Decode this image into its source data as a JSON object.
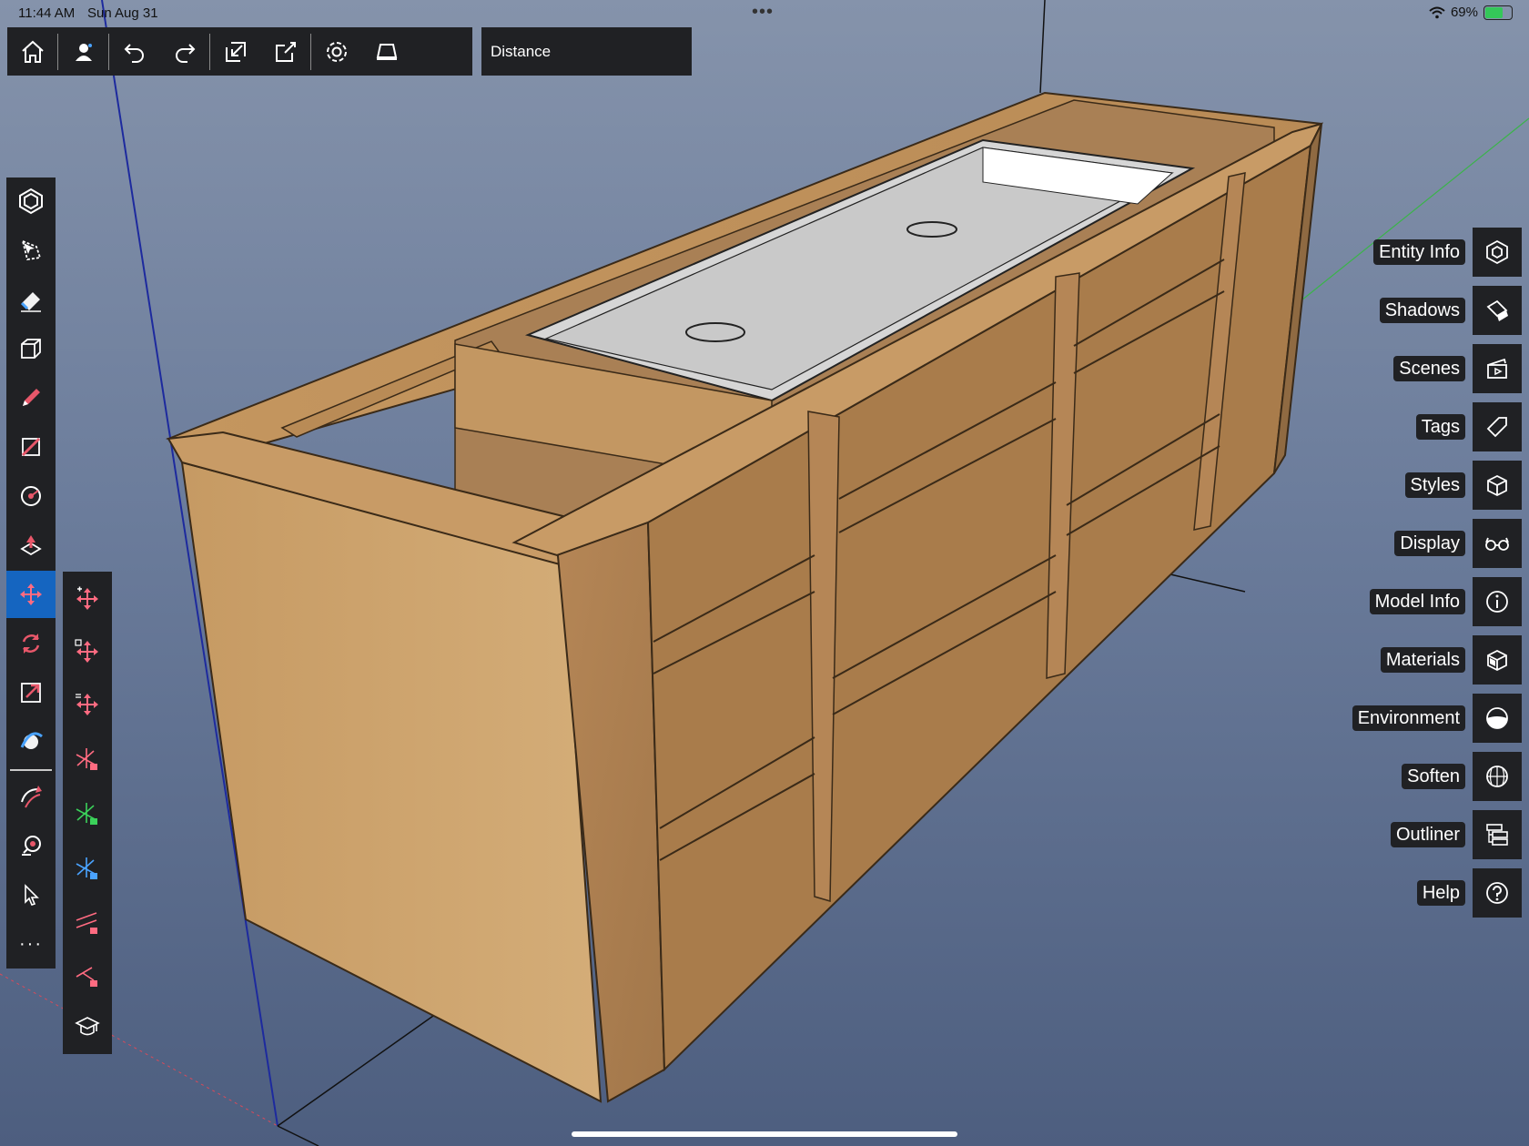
{
  "status_bar": {
    "time": "11:44 AM",
    "date": "Sun Aug 31",
    "battery": "69%",
    "battery_level": 0.69
  },
  "toolbar": {
    "buttons": [
      "home-icon",
      "profile-icon",
      "undo-icon",
      "redo-icon",
      "import-icon",
      "export-icon",
      "settings-icon",
      "view-icon"
    ],
    "measurement_label": "Distance"
  },
  "left_tools": [
    "select-all-icon",
    "lasso-icon",
    "eraser-icon",
    "push-pull-icon",
    "pencil-icon",
    "rectangle-icon",
    "circle-icon",
    "paint-bucket-icon",
    "move-icon",
    "rotate-icon",
    "scale-icon",
    "orbit-icon",
    "follow-me-icon",
    "tape-measure-icon",
    "select-icon",
    "more-icon"
  ],
  "move_sub_tools": [
    "move-icon",
    "move-copy-icon",
    "move-array-icon",
    "lock-red-axis-icon",
    "lock-green-axis-icon",
    "lock-blue-axis-icon",
    "lock-parallel-icon",
    "lock-perpendicular-icon",
    "tutorial-icon"
  ],
  "colors": {
    "toolbar_bg": "#202124",
    "active_tool": "#1565c0",
    "axis_red": "#d84a5a",
    "axis_blue": "#1d2a9e",
    "axis_green": "#3bb34a"
  },
  "panels": [
    {
      "label": "Entity Info",
      "icon": "entity-info-icon"
    },
    {
      "label": "Shadows",
      "icon": "shadows-icon"
    },
    {
      "label": "Scenes",
      "icon": "scenes-icon"
    },
    {
      "label": "Tags",
      "icon": "tags-icon"
    },
    {
      "label": "Styles",
      "icon": "styles-icon"
    },
    {
      "label": "Display",
      "icon": "display-icon"
    },
    {
      "label": "Model Info",
      "icon": "model-info-icon"
    },
    {
      "label": "Materials",
      "icon": "materials-icon"
    },
    {
      "label": "Environment",
      "icon": "environment-icon"
    },
    {
      "label": "Soften",
      "icon": "soften-icon"
    },
    {
      "label": "Outliner",
      "icon": "outliner-icon"
    },
    {
      "label": "Help",
      "icon": "help-icon"
    }
  ]
}
